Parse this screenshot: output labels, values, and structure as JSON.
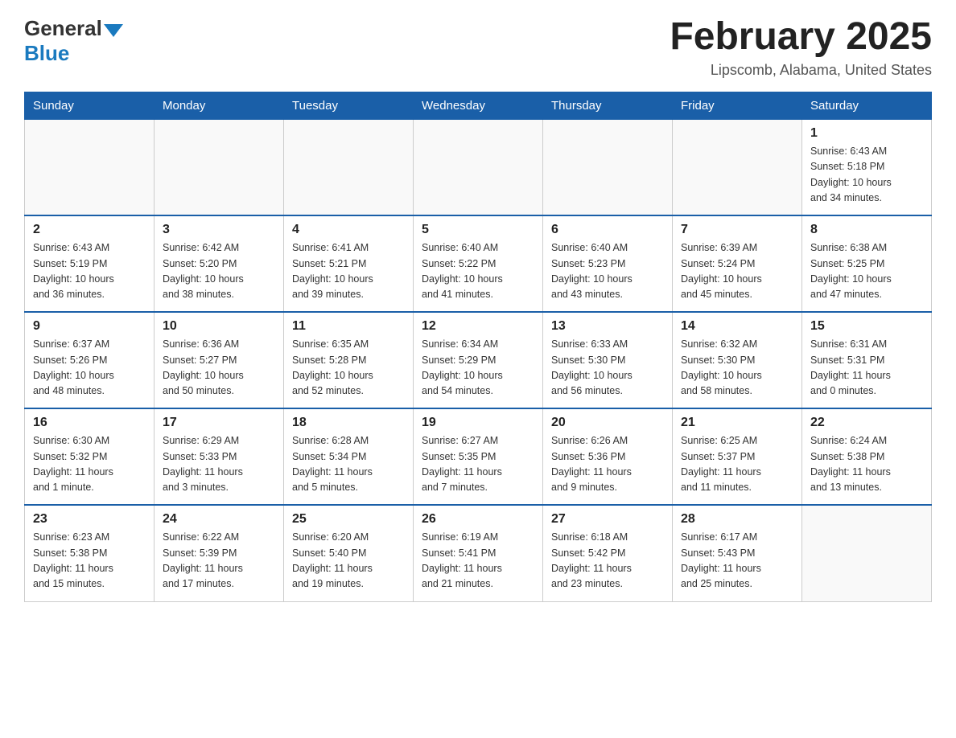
{
  "header": {
    "logo_general": "General",
    "logo_blue": "Blue",
    "title": "February 2025",
    "subtitle": "Lipscomb, Alabama, United States"
  },
  "days_of_week": [
    "Sunday",
    "Monday",
    "Tuesday",
    "Wednesday",
    "Thursday",
    "Friday",
    "Saturday"
  ],
  "weeks": [
    {
      "days": [
        {
          "number": "",
          "info": ""
        },
        {
          "number": "",
          "info": ""
        },
        {
          "number": "",
          "info": ""
        },
        {
          "number": "",
          "info": ""
        },
        {
          "number": "",
          "info": ""
        },
        {
          "number": "",
          "info": ""
        },
        {
          "number": "1",
          "info": "Sunrise: 6:43 AM\nSunset: 5:18 PM\nDaylight: 10 hours\nand 34 minutes."
        }
      ]
    },
    {
      "days": [
        {
          "number": "2",
          "info": "Sunrise: 6:43 AM\nSunset: 5:19 PM\nDaylight: 10 hours\nand 36 minutes."
        },
        {
          "number": "3",
          "info": "Sunrise: 6:42 AM\nSunset: 5:20 PM\nDaylight: 10 hours\nand 38 minutes."
        },
        {
          "number": "4",
          "info": "Sunrise: 6:41 AM\nSunset: 5:21 PM\nDaylight: 10 hours\nand 39 minutes."
        },
        {
          "number": "5",
          "info": "Sunrise: 6:40 AM\nSunset: 5:22 PM\nDaylight: 10 hours\nand 41 minutes."
        },
        {
          "number": "6",
          "info": "Sunrise: 6:40 AM\nSunset: 5:23 PM\nDaylight: 10 hours\nand 43 minutes."
        },
        {
          "number": "7",
          "info": "Sunrise: 6:39 AM\nSunset: 5:24 PM\nDaylight: 10 hours\nand 45 minutes."
        },
        {
          "number": "8",
          "info": "Sunrise: 6:38 AM\nSunset: 5:25 PM\nDaylight: 10 hours\nand 47 minutes."
        }
      ]
    },
    {
      "days": [
        {
          "number": "9",
          "info": "Sunrise: 6:37 AM\nSunset: 5:26 PM\nDaylight: 10 hours\nand 48 minutes."
        },
        {
          "number": "10",
          "info": "Sunrise: 6:36 AM\nSunset: 5:27 PM\nDaylight: 10 hours\nand 50 minutes."
        },
        {
          "number": "11",
          "info": "Sunrise: 6:35 AM\nSunset: 5:28 PM\nDaylight: 10 hours\nand 52 minutes."
        },
        {
          "number": "12",
          "info": "Sunrise: 6:34 AM\nSunset: 5:29 PM\nDaylight: 10 hours\nand 54 minutes."
        },
        {
          "number": "13",
          "info": "Sunrise: 6:33 AM\nSunset: 5:30 PM\nDaylight: 10 hours\nand 56 minutes."
        },
        {
          "number": "14",
          "info": "Sunrise: 6:32 AM\nSunset: 5:30 PM\nDaylight: 10 hours\nand 58 minutes."
        },
        {
          "number": "15",
          "info": "Sunrise: 6:31 AM\nSunset: 5:31 PM\nDaylight: 11 hours\nand 0 minutes."
        }
      ]
    },
    {
      "days": [
        {
          "number": "16",
          "info": "Sunrise: 6:30 AM\nSunset: 5:32 PM\nDaylight: 11 hours\nand 1 minute."
        },
        {
          "number": "17",
          "info": "Sunrise: 6:29 AM\nSunset: 5:33 PM\nDaylight: 11 hours\nand 3 minutes."
        },
        {
          "number": "18",
          "info": "Sunrise: 6:28 AM\nSunset: 5:34 PM\nDaylight: 11 hours\nand 5 minutes."
        },
        {
          "number": "19",
          "info": "Sunrise: 6:27 AM\nSunset: 5:35 PM\nDaylight: 11 hours\nand 7 minutes."
        },
        {
          "number": "20",
          "info": "Sunrise: 6:26 AM\nSunset: 5:36 PM\nDaylight: 11 hours\nand 9 minutes."
        },
        {
          "number": "21",
          "info": "Sunrise: 6:25 AM\nSunset: 5:37 PM\nDaylight: 11 hours\nand 11 minutes."
        },
        {
          "number": "22",
          "info": "Sunrise: 6:24 AM\nSunset: 5:38 PM\nDaylight: 11 hours\nand 13 minutes."
        }
      ]
    },
    {
      "days": [
        {
          "number": "23",
          "info": "Sunrise: 6:23 AM\nSunset: 5:38 PM\nDaylight: 11 hours\nand 15 minutes."
        },
        {
          "number": "24",
          "info": "Sunrise: 6:22 AM\nSunset: 5:39 PM\nDaylight: 11 hours\nand 17 minutes."
        },
        {
          "number": "25",
          "info": "Sunrise: 6:20 AM\nSunset: 5:40 PM\nDaylight: 11 hours\nand 19 minutes."
        },
        {
          "number": "26",
          "info": "Sunrise: 6:19 AM\nSunset: 5:41 PM\nDaylight: 11 hours\nand 21 minutes."
        },
        {
          "number": "27",
          "info": "Sunrise: 6:18 AM\nSunset: 5:42 PM\nDaylight: 11 hours\nand 23 minutes."
        },
        {
          "number": "28",
          "info": "Sunrise: 6:17 AM\nSunset: 5:43 PM\nDaylight: 11 hours\nand 25 minutes."
        },
        {
          "number": "",
          "info": ""
        }
      ]
    }
  ]
}
